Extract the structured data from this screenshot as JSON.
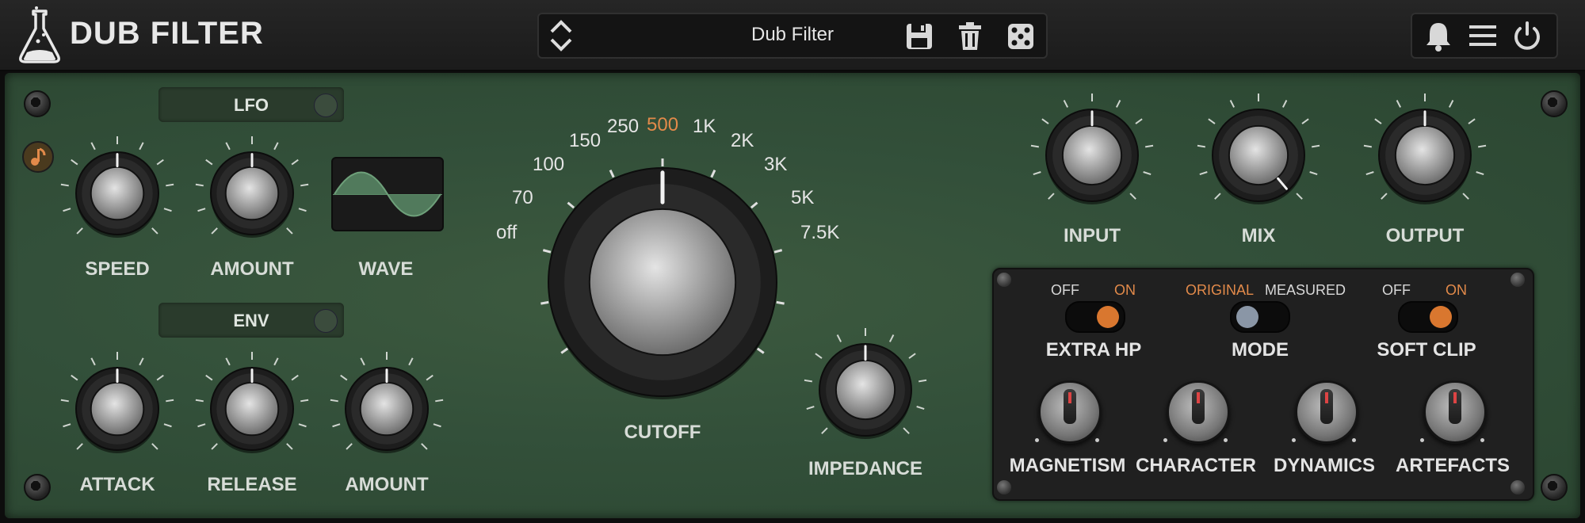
{
  "app": {
    "title": "DUB FILTER"
  },
  "preset": {
    "name": "Dub Filter"
  },
  "lfo": {
    "header": "LFO",
    "speed_label": "SPEED",
    "amount_label": "AMOUNT",
    "wave_label": "WAVE"
  },
  "env": {
    "header": "ENV",
    "attack_label": "ATTACK",
    "release_label": "RELEASE",
    "amount_label": "AMOUNT"
  },
  "cutoff": {
    "label": "CUTOFF",
    "scale": [
      "off",
      "70",
      "100",
      "150",
      "250",
      "500",
      "1K",
      "2K",
      "3K",
      "5K",
      "7.5K"
    ],
    "selected": "500"
  },
  "impedance": {
    "label": "IMPEDANCE"
  },
  "io": {
    "input_label": "INPUT",
    "mix_label": "MIX",
    "output_label": "OUTPUT"
  },
  "extra_hp": {
    "label": "EXTRA HP",
    "off": "OFF",
    "on": "ON",
    "state": "ON"
  },
  "mode": {
    "label": "MODE",
    "original": "ORIGINAL",
    "measured": "MEASURED",
    "state": "ORIGINAL"
  },
  "soft_clip": {
    "label": "SOFT CLIP",
    "off": "OFF",
    "on": "ON",
    "state": "ON"
  },
  "characters": {
    "magnetism": "MAGNETISM",
    "character": "CHARACTER",
    "dynamics": "DYNAMICS",
    "artefacts": "ARTEFACTS"
  },
  "colors": {
    "accent": "#e28a4a",
    "panel": "#33503a",
    "dark": "#202020"
  }
}
